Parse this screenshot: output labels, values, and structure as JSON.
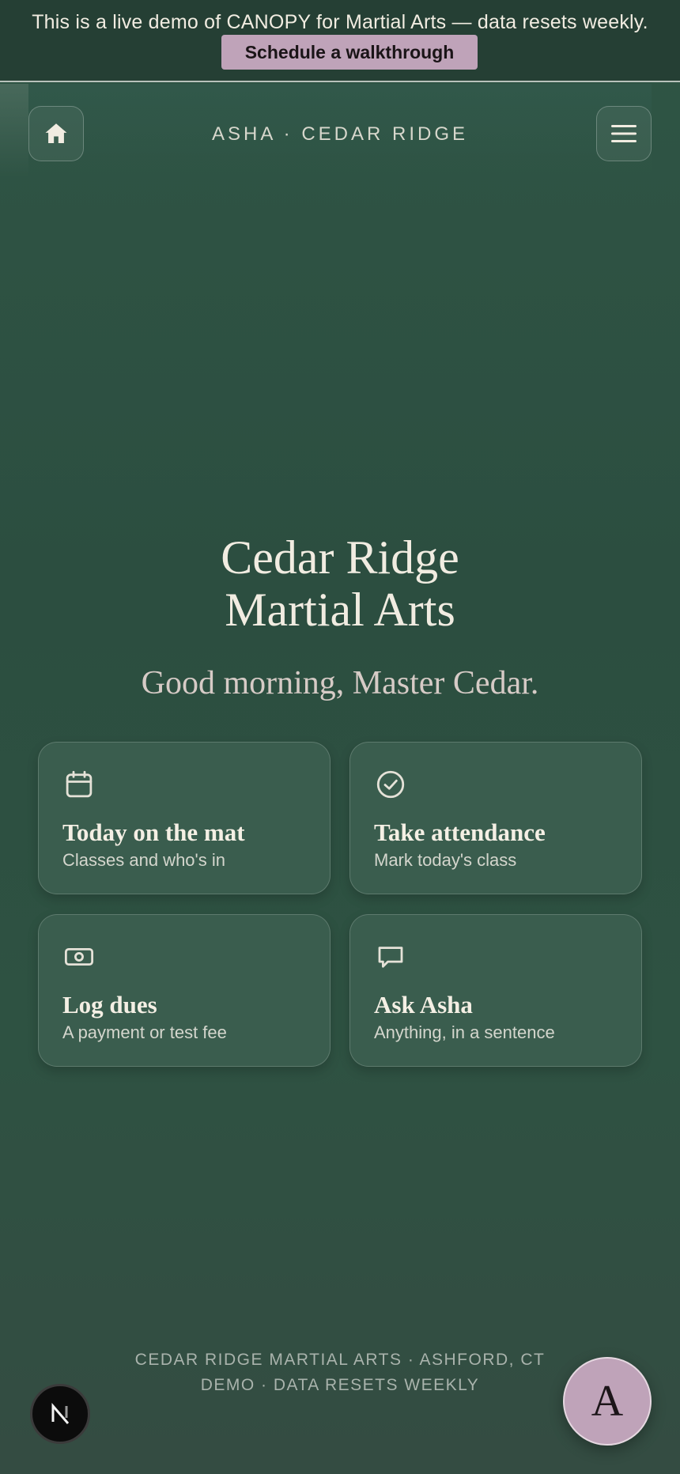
{
  "demo_banner": {
    "text": "This is a live demo of CANOPY for Martial Arts — data resets weekly.",
    "cta_label": "Schedule a walkthrough"
  },
  "topbar": {
    "title": "ASHA · CEDAR RIDGE",
    "home_icon": "home-icon",
    "menu_icon": "hamburger-menu-icon"
  },
  "hero": {
    "title_line1": "Cedar Ridge",
    "title_line2": "Martial Arts",
    "greeting": "Good morning, Master Cedar."
  },
  "cards": [
    {
      "icon": "calendar-icon",
      "title": "Today on the mat",
      "subtitle": "Classes and who's in"
    },
    {
      "icon": "check-circle-icon",
      "title": "Take attendance",
      "subtitle": "Mark today's class"
    },
    {
      "icon": "cash-icon",
      "title": "Log dues",
      "subtitle": "A payment or test fee"
    },
    {
      "icon": "chat-icon",
      "title": "Ask Asha",
      "subtitle": "Anything, in a sentence"
    }
  ],
  "footer": {
    "line1": "CEDAR RIDGE MARTIAL ARTS · ASHFORD, CT",
    "line2": "DEMO · DATA RESETS WEEKLY"
  },
  "badge": {
    "label": "N"
  },
  "assistant_fab": {
    "label": "A"
  },
  "colors": {
    "background": "#2e5242",
    "banner": "#253f34",
    "accent": "#bfa3b9",
    "card": "#3a5d4e",
    "text": "#f1ece1"
  }
}
